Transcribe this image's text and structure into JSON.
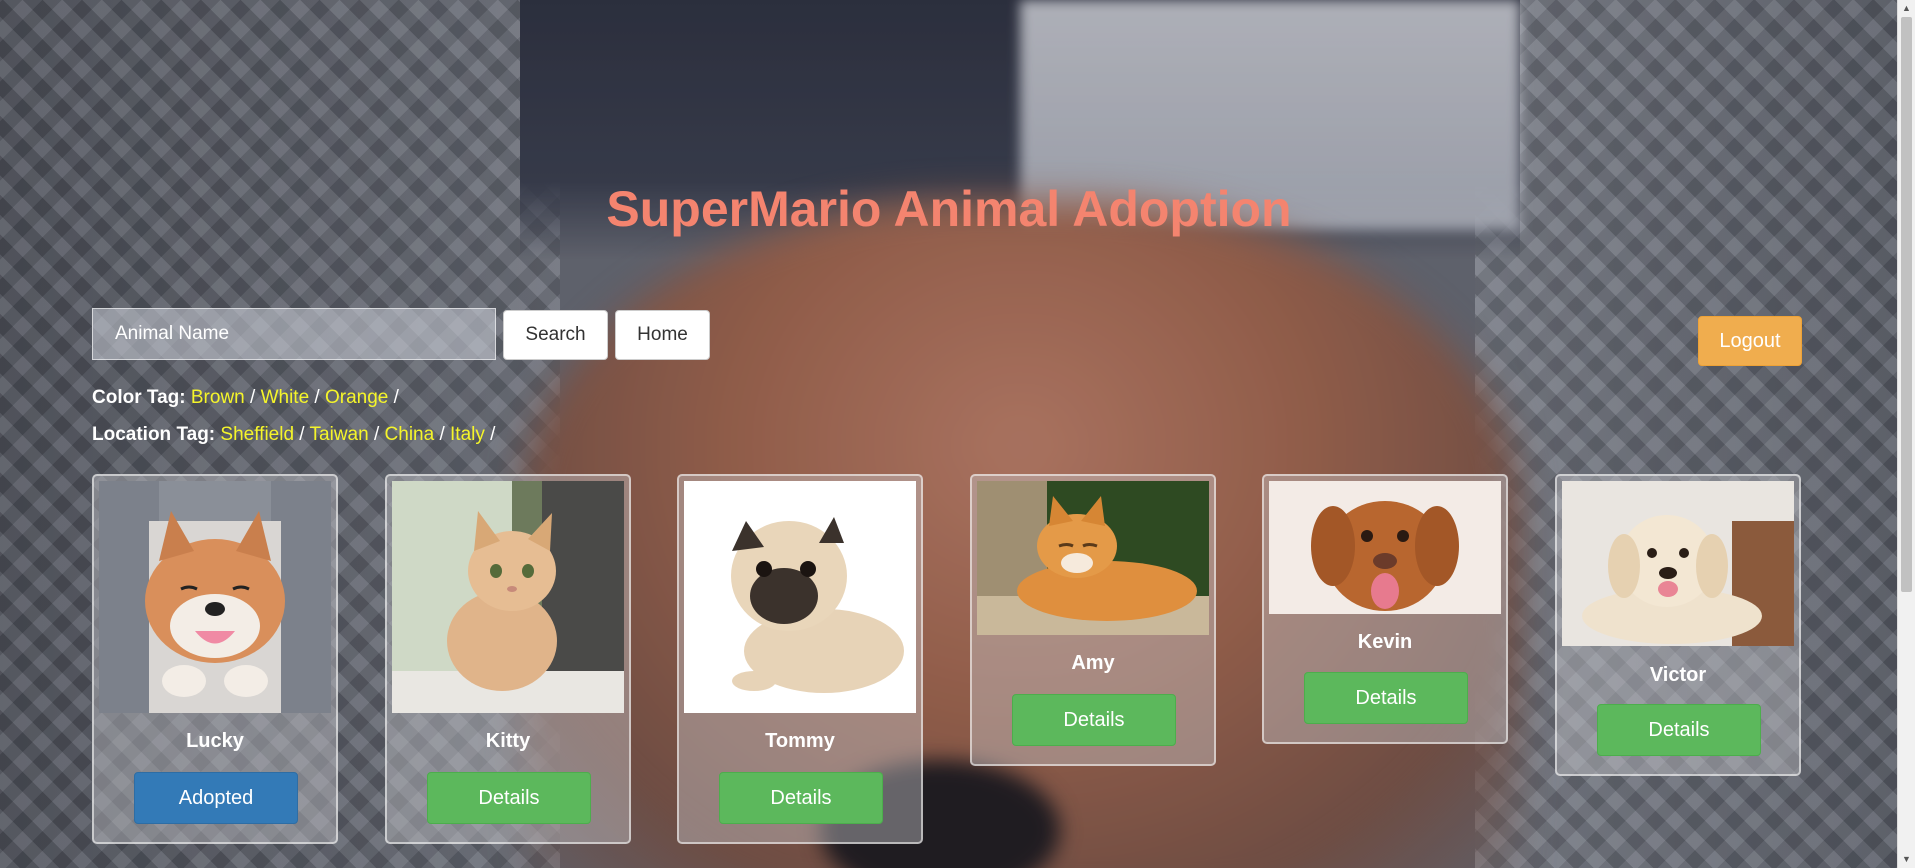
{
  "header": {
    "title": "SuperMario Animal Adoption"
  },
  "search": {
    "placeholder": "Animal Name",
    "search_label": "Search",
    "home_label": "Home"
  },
  "logout_label": "Logout",
  "color_tags": {
    "label": "Color Tag:",
    "items": [
      "Brown",
      "White",
      "Orange"
    ]
  },
  "location_tags": {
    "label": "Location Tag:",
    "items": [
      "Sheffield",
      "Taiwan",
      "China",
      "Italy"
    ]
  },
  "animals": [
    {
      "name": "Lucky",
      "action": "Adopted"
    },
    {
      "name": "Kitty",
      "action": "Details"
    },
    {
      "name": "Tommy",
      "action": "Details"
    },
    {
      "name": "Amy",
      "action": "Details"
    },
    {
      "name": "Kevin",
      "action": "Details"
    },
    {
      "name": "Victor",
      "action": "Details"
    }
  ],
  "colors": {
    "title": "#f4846f",
    "tag_link": "#f5f52a",
    "details_button": "#5cb85c",
    "adopted_button": "#337ab7",
    "logout_button": "#f0ad4e"
  }
}
